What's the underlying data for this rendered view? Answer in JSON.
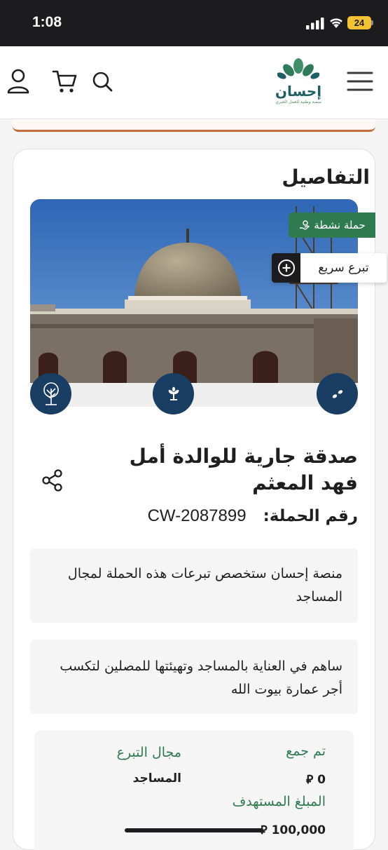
{
  "status_bar": {
    "time": "1:08",
    "battery": "24"
  },
  "header": {
    "logo": {
      "name": "إحسان",
      "tagline": "منصة وطنية للعمل الخيري"
    }
  },
  "details": {
    "section_title": "التفاصيل",
    "active_badge": "حملة نشطة",
    "quick_donate": "تبرع سريع",
    "title": "صدقة جارية للوالدة أمل فهد المعثم",
    "campaign_number_label": "رقم الحملة:",
    "campaign_number": "CW-2087899",
    "allocation_note": "منصة إحسان ستخصص تبرعات هذه الحملة لمجال المساجد",
    "description": "ساهم في العناية بالمساجد وتهيئتها للمصلين لتكسب أجر عمارة بيوت الله"
  },
  "stats": {
    "collected_label": "تم جمع",
    "collected_value": "0",
    "field_label": "مجال التبرع",
    "field_value": "المساجد",
    "target_label": "المبلغ المستهدف",
    "target_value": "100,000",
    "currency_symbol": "⃁"
  },
  "progress": {
    "collected_fraction": 0
  },
  "colors": {
    "brand_green": "#2f7a4f",
    "navy": "#193d63",
    "accent_orange": "#c76a3a"
  }
}
